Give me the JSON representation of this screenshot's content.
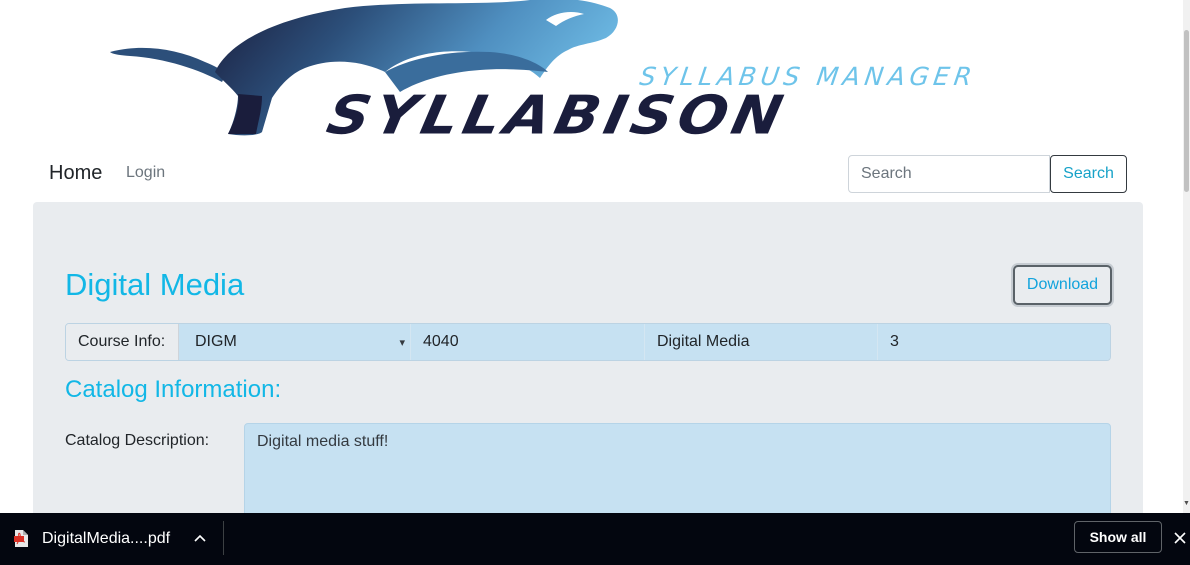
{
  "logo": {
    "subtitle": "SYLLABUS MANAGER",
    "title": "SYLLABISON",
    "icon": "bison-icon"
  },
  "nav": {
    "home": "Home",
    "login": "Login",
    "search_placeholder": "Search",
    "search_button": "Search"
  },
  "course": {
    "title": "Digital Media",
    "download_label": "Download",
    "info_label": "Course Info:",
    "department": "DIGM",
    "number": "4040",
    "name": "Digital Media",
    "credits": "3"
  },
  "catalog": {
    "heading": "Catalog Information:",
    "description_label": "Catalog Description:",
    "description": "Digital media stuff!"
  },
  "download_shelf": {
    "filename": "DigitalMedia....pdf",
    "file_icon": "pdf-file-icon",
    "show_all": "Show all"
  },
  "colors": {
    "accent": "#12b7e6",
    "logo_dark": "#1a1d3c",
    "logo_light": "#6ec4ea",
    "panel_bg": "#e9ecef",
    "field_bg": "#c6e1f2",
    "shelf_bg": "#03060f"
  }
}
